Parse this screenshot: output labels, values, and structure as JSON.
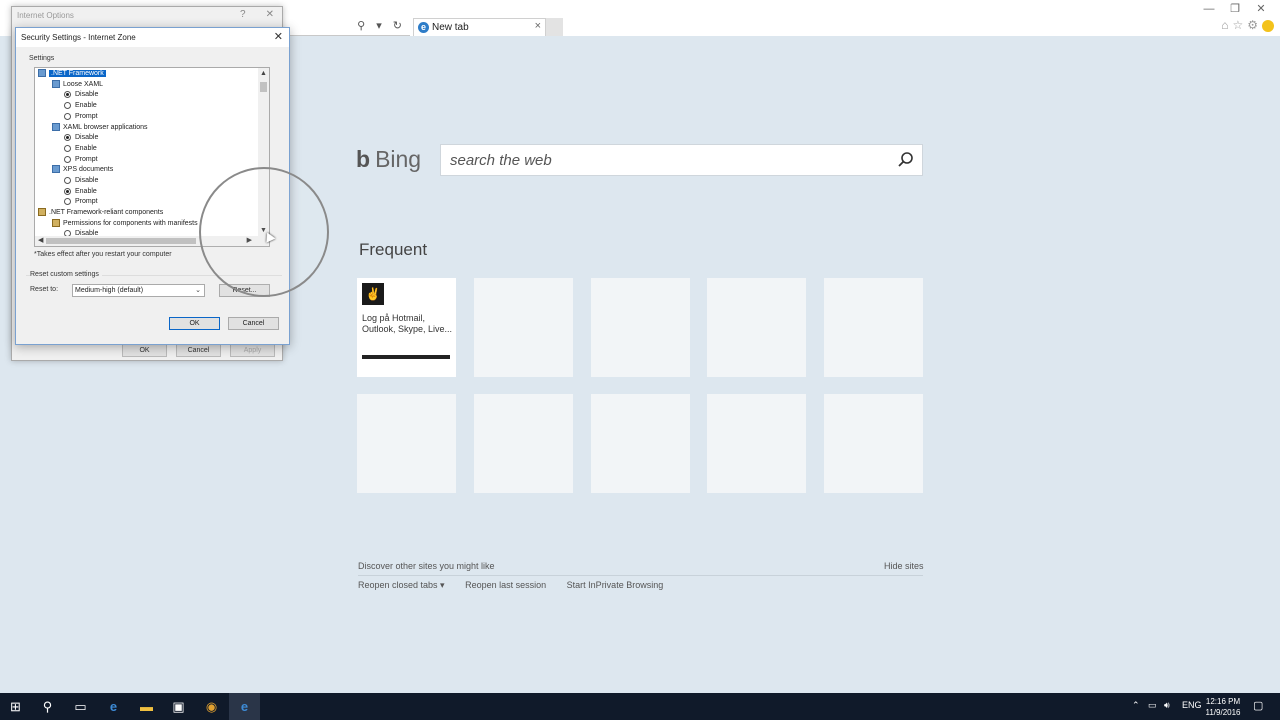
{
  "browser": {
    "tab_title": "New tab",
    "tab_close": "×",
    "addr_icons": "⚲ ▾ ↻",
    "window_controls": [
      "—",
      "❐",
      "✕"
    ]
  },
  "newtab": {
    "bing_label": "Bing",
    "search_placeholder": "search the web",
    "frequent_heading": "Frequent",
    "tiles": [
      {
        "label": "Log på Hotmail, Outlook, Skype, Live..."
      }
    ],
    "discover_text": "Discover other sites you might like",
    "hide_sites": "Hide sites",
    "reopen_closed": "Reopen closed tabs ▾",
    "reopen_last": "Reopen last session",
    "inprivate": "Start InPrivate Browsing"
  },
  "internet_options": {
    "title": "Internet Options",
    "help": "?",
    "close": "✕",
    "ok": "OK",
    "cancel": "Cancel",
    "apply": "Apply"
  },
  "security_settings": {
    "title": "Security Settings - Internet Zone",
    "close": "✕",
    "settings_label": "Settings",
    "tree": [
      {
        "label": ".NET Framework",
        "kind": "cat",
        "selected": true
      },
      {
        "label": "Loose XAML",
        "kind": "sub"
      },
      {
        "label": "Disable",
        "kind": "opt",
        "checked": true
      },
      {
        "label": "Enable",
        "kind": "opt",
        "checked": false
      },
      {
        "label": "Prompt",
        "kind": "opt",
        "checked": false
      },
      {
        "label": "XAML browser applications",
        "kind": "sub"
      },
      {
        "label": "Disable",
        "kind": "opt",
        "checked": true
      },
      {
        "label": "Enable",
        "kind": "opt",
        "checked": false
      },
      {
        "label": "Prompt",
        "kind": "opt",
        "checked": false
      },
      {
        "label": "XPS documents",
        "kind": "sub"
      },
      {
        "label": "Disable",
        "kind": "opt",
        "checked": false
      },
      {
        "label": "Enable",
        "kind": "opt",
        "checked": true
      },
      {
        "label": "Prompt",
        "kind": "opt",
        "checked": false
      },
      {
        "label": ".NET Framework-reliant components",
        "kind": "cat2"
      },
      {
        "label": "Permissions for components with manifests",
        "kind": "sub2"
      },
      {
        "label": "Disable",
        "kind": "opt",
        "checked": false
      }
    ],
    "note": "*Takes effect after you restart your computer",
    "reset_group": "Reset custom settings",
    "reset_to_label": "Reset to:",
    "reset_level": "Medium-high (default)",
    "reset_button": "Reset...",
    "ok": "OK",
    "cancel": "Cancel"
  },
  "taskbar": {
    "language": "ENG",
    "time": "12:16 PM",
    "date": "11/9/2016"
  }
}
